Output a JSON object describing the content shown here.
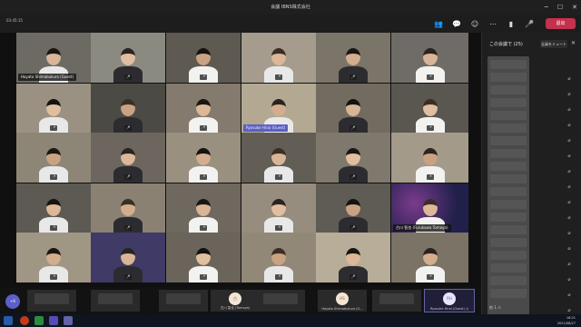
{
  "window": {
    "title": "会議 IBNS株式会社"
  },
  "toolbar": {
    "timer": "03:45:15",
    "leave_label": "退出"
  },
  "participants": [
    {
      "name": "Hayato Shimabukuro (Guest)"
    },
    {
      "name": "Ryosuke Hirai (Guest)"
    },
    {
      "name": "古川 智也 (Furukawa Tomoya)"
    }
  ],
  "strip": {
    "add_label": "+6",
    "items": [
      {
        "initials": "",
        "label": ""
      },
      {
        "initials": "",
        "label": ""
      },
      {
        "initials": "",
        "label": ""
      },
      {
        "initials": "古",
        "label": "古川 智也 (Tomoya)"
      },
      {
        "initials": "",
        "label": ""
      },
      {
        "initials": "HS",
        "label": "Hayato Shimabukuro (G..."
      },
      {
        "initials": "",
        "label": ""
      },
      {
        "initials": "RH",
        "label": "Ryosuke Hirai (Guest) ◎"
      },
      {
        "initials": "",
        "label": ""
      }
    ]
  },
  "panel": {
    "header": "この会議で (25)",
    "share_label": "全員をミュート",
    "footer": "他 1 人"
  },
  "taskbar": {
    "time": "16:21",
    "date": "2021/08/27"
  },
  "colors": {
    "accent": "#5b5fc7",
    "leave": "#c4314b"
  }
}
